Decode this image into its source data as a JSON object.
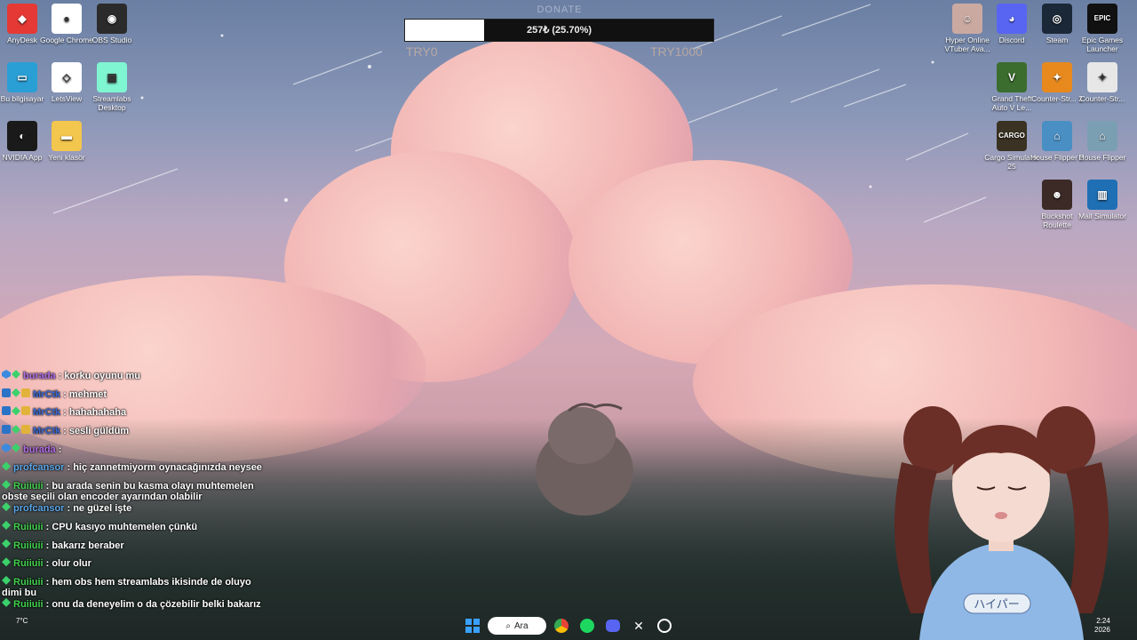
{
  "donate": {
    "title": "DONATE",
    "progress_text": "257₺ (25.70%)",
    "progress_fraction": 0.257,
    "min_label": "TRY0",
    "max_label": "TRY1000"
  },
  "desktop_left": [
    {
      "label": "AnyDesk",
      "color": "#e53935",
      "glyph": "◆"
    },
    {
      "label": "Google Chrome",
      "color": "#ffffff",
      "glyph": "●"
    },
    {
      "label": "OBS Studio",
      "color": "#2b2b2b",
      "glyph": "◉"
    },
    {
      "label": "Bu bilgisayar",
      "color": "#2a9fd6",
      "glyph": "▭"
    },
    {
      "label": "LetsView",
      "color": "#ffffff",
      "glyph": "◇"
    },
    {
      "label": "Streamlabs Desktop",
      "color": "#80f5d2",
      "glyph": "▣"
    },
    {
      "label": "NVIDIA App",
      "color": "#1a1a1a",
      "glyph": "◐"
    },
    {
      "label": "Yeni klasör",
      "color": "#f3c64d",
      "glyph": "▬"
    }
  ],
  "desktop_right": [
    {
      "label": "Hyper Online VTuber Ava...",
      "color": "#caa9a1",
      "glyph": "☺"
    },
    {
      "label": "Discord",
      "color": "#5865f2",
      "glyph": "◕"
    },
    {
      "label": "Steam",
      "color": "#1b2838",
      "glyph": "◎"
    },
    {
      "label": "Epic Games Launcher",
      "color": "#111111",
      "glyph": "EPIC"
    },
    {
      "label": "Grand Theft Auto V Le...",
      "color": "#3b6d2e",
      "glyph": "V"
    },
    {
      "label": "Counter-Str... 2",
      "color": "#e8891d",
      "glyph": "✦"
    },
    {
      "label": "Counter-Str...",
      "color": "#e7e7e7",
      "glyph": "✦"
    },
    {
      "label": "Cargo Simulator 25",
      "color": "#3a3222",
      "glyph": "CARGO"
    },
    {
      "label": "House Flipper 2",
      "color": "#4a8fc3",
      "glyph": "⌂"
    },
    {
      "label": "House Flipper",
      "color": "#7b9fb2",
      "glyph": "⌂"
    },
    {
      "label": "Buckshot Roulette",
      "color": "#3b2a25",
      "glyph": "☻"
    },
    {
      "label": "Mall Simulator",
      "color": "#1f6fb5",
      "glyph": "▥"
    }
  ],
  "chat": [
    {
      "user": "burada",
      "user_color": "#b26ee8",
      "text": "korku oyunu mu",
      "badges": [
        "blue",
        "green"
      ]
    },
    {
      "user": "MrCtk",
      "user_color": "#3c6ad6",
      "text": "mehmet",
      "badges": [
        "mod",
        "green",
        "gold"
      ]
    },
    {
      "user": "MrCtk",
      "user_color": "#3c6ad6",
      "text": "hahahahaha",
      "badges": [
        "mod",
        "green",
        "gold"
      ]
    },
    {
      "user": "MrCtk",
      "user_color": "#3c6ad6",
      "text": "sesli güldüm",
      "badges": [
        "mod",
        "green",
        "gold"
      ]
    },
    {
      "user": "burada",
      "user_color": "#b26ee8",
      "text": "",
      "badges": [
        "blue",
        "green"
      ]
    },
    {
      "user": "profcansor",
      "user_color": "#5aa6e8",
      "text": "hiç zannetmiyorm oynacağınızda neysee",
      "badges": [
        "green"
      ]
    },
    {
      "user": "Ruiiuii",
      "user_color": "#43d14f",
      "text": "bu arada senin bu kasma olayı muhtemelen obste seçili olan encoder ayarından olabilir",
      "badges": [
        "green"
      ]
    },
    {
      "user": "profcansor",
      "user_color": "#5aa6e8",
      "text": "ne güzel işte",
      "badges": [
        "green"
      ]
    },
    {
      "user": "Ruiiuii",
      "user_color": "#43d14f",
      "text": "CPU kasıyo muhtemelen çünkü",
      "badges": [
        "green"
      ]
    },
    {
      "user": "Ruiiuii",
      "user_color": "#43d14f",
      "text": "bakarız beraber",
      "badges": [
        "green"
      ]
    },
    {
      "user": "Ruiiuii",
      "user_color": "#43d14f",
      "text": "olur olur",
      "badges": [
        "green"
      ]
    },
    {
      "user": "Ruiiuii",
      "user_color": "#43d14f",
      "text": "hem obs hem streamlabs ikisinde de oluyo dimi bu",
      "badges": [
        "green"
      ]
    },
    {
      "user": "Ruiiuii",
      "user_color": "#43d14f",
      "text": "onu da deneyelim o da çözebilir belki bakarız",
      "badges": [
        "green"
      ]
    }
  ],
  "taskbar": {
    "search_label": "Ara",
    "weather": "7°C",
    "time": "2:24",
    "date": "2026"
  },
  "vtuber": {
    "shirt_text": "ハイパー"
  }
}
